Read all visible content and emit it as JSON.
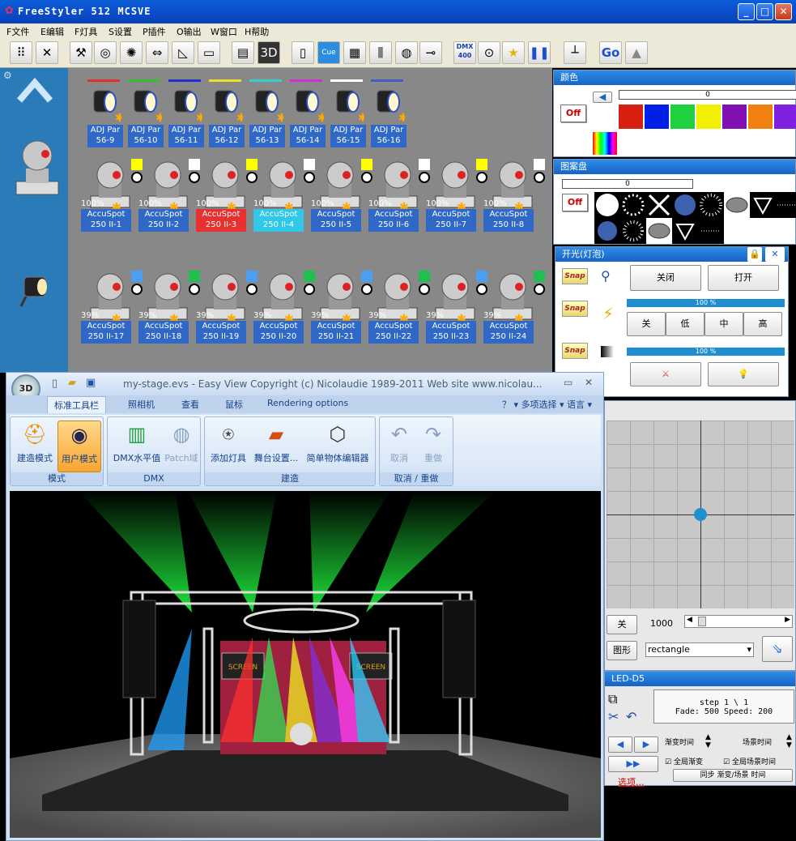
{
  "app": {
    "title": "FreeStyler 512 MCSVE"
  },
  "menu": [
    "F文件",
    "E编辑",
    "F灯具",
    "S设置",
    "P插件",
    "O输出",
    "W窗口",
    "H帮助"
  ],
  "toolbar": {
    "dmx_label": "DMX\n400",
    "go_label": "Go"
  },
  "par_fixtures": [
    {
      "name": "ADJ Par",
      "id": "56-9",
      "color": "#e03030"
    },
    {
      "name": "ADJ Par",
      "id": "56-10",
      "color": "#30c030"
    },
    {
      "name": "ADJ Par",
      "id": "56-11",
      "color": "#2030d0"
    },
    {
      "name": "ADJ Par",
      "id": "56-12",
      "color": "#e8e020"
    },
    {
      "name": "ADJ Par",
      "id": "56-13",
      "color": "#30d0d0"
    },
    {
      "name": "ADJ Par",
      "id": "56-14",
      "color": "#d030d0"
    },
    {
      "name": "ADJ Par",
      "id": "56-15",
      "color": "#ffffff"
    },
    {
      "name": "ADJ Par",
      "id": "56-16",
      "color": "#4060c0"
    }
  ],
  "spots_row1": [
    {
      "pct": "100%",
      "name": "AccuSpot",
      "id": "250 II-1",
      "color": "#ffff00",
      "bg": "#3068c8"
    },
    {
      "pct": "100%",
      "name": "AccuSpot",
      "id": "250 II-2",
      "color": "#ffffff",
      "bg": "#3068c8"
    },
    {
      "pct": "100%",
      "name": "AccuSpot",
      "id": "250 II-3",
      "color": "#ffff00",
      "bg": "#e83030"
    },
    {
      "pct": "100%",
      "name": "AccuSpot",
      "id": "250 II-4",
      "color": "#ffffff",
      "bg": "#30c8e8"
    },
    {
      "pct": "100%",
      "name": "AccuSpot",
      "id": "250 II-5",
      "color": "#ffff00",
      "bg": "#3068c8"
    },
    {
      "pct": "100%",
      "name": "AccuSpot",
      "id": "250 II-6",
      "color": "#ffffff",
      "bg": "#3068c8"
    },
    {
      "pct": "100%",
      "name": "AccuSpot",
      "id": "250 II-7",
      "color": "#ffff00",
      "bg": "#3068c8"
    },
    {
      "pct": "100%",
      "name": "AccuSpot",
      "id": "250 II-8",
      "color": "#ffffff",
      "bg": "#3068c8"
    }
  ],
  "spots_row2": [
    {
      "pct": "39%",
      "name": "AccuSpot",
      "id": "250 II-17",
      "color": "#4aa0f0"
    },
    {
      "pct": "39%",
      "name": "AccuSpot",
      "id": "250 II-18",
      "color": "#20c050"
    },
    {
      "pct": "39%",
      "name": "AccuSpot",
      "id": "250 II-19",
      "color": "#4aa0f0"
    },
    {
      "pct": "39%",
      "name": "AccuSpot",
      "id": "250 II-20",
      "color": "#20c050"
    },
    {
      "pct": "39%",
      "name": "AccuSpot",
      "id": "250 II-21",
      "color": "#4aa0f0"
    },
    {
      "pct": "39%",
      "name": "AccuSpot",
      "id": "250 II-22",
      "color": "#20c050"
    },
    {
      "pct": "39%",
      "name": "AccuSpot",
      "id": "250 II-23",
      "color": "#4aa0f0"
    },
    {
      "pct": "39%",
      "name": "AccuSpot",
      "id": "250 II-24",
      "color": "#20c050"
    }
  ],
  "color_panel": {
    "title": "颜色",
    "off": "Off",
    "value": "0",
    "swatches": [
      "#d82010",
      "#0020e8",
      "#20d040",
      "#f0f000",
      "#8010b0",
      "#f08010",
      "#8020e0"
    ]
  },
  "gobo_panel": {
    "title": "图案盘",
    "off": "Off",
    "value": "0"
  },
  "shutter_panel": {
    "title": "开光(灯泡)",
    "snap": "Snap",
    "close": "关闭",
    "open": "打开",
    "dim_pct": "100 %",
    "speed_pct": "100 %",
    "off": "关",
    "low": "低",
    "mid": "中",
    "high": "高"
  },
  "easyview": {
    "title": "my-stage.evs - Easy View   Copyright (c) Nicolaudie 1989-2011   Web site www.nicolau...",
    "tabs": [
      "标准工具栏",
      "照相机",
      "查看",
      "鼠标",
      "Rendering options"
    ],
    "right_menu": "？ ▾ 多项选择 ▾ 语言 ▾",
    "groups": {
      "mode": "模式",
      "dmx": "DMX",
      "build": "建造",
      "undo": "取消 / 重做"
    },
    "buttons": {
      "build_mode": "建造模式",
      "user_mode": "用户模式",
      "dmx_level": "DMX水平值",
      "patch": "Patch域",
      "add_fixture": "添加灯具",
      "stage_setup": "舞台设置...",
      "object_editor": "简单物体编辑器",
      "undo": "取消",
      "redo": "重做"
    },
    "screen_label": "SCREEN"
  },
  "shapes_panel": {
    "off": "关",
    "size": "1000",
    "shape_label": "图形",
    "shape_value": "rectangle"
  },
  "led_panel": {
    "title": "LED-D5",
    "step": "step 1 \\ 1",
    "fade": "Fade: 500   Speed: 200",
    "fade_time": "渐变时间",
    "scene_time": "场景时间",
    "global_fade": "全局渐变",
    "global_scene": "全局场景时间",
    "sync": "同步 渐变/场景 时间",
    "options": "选项..."
  }
}
